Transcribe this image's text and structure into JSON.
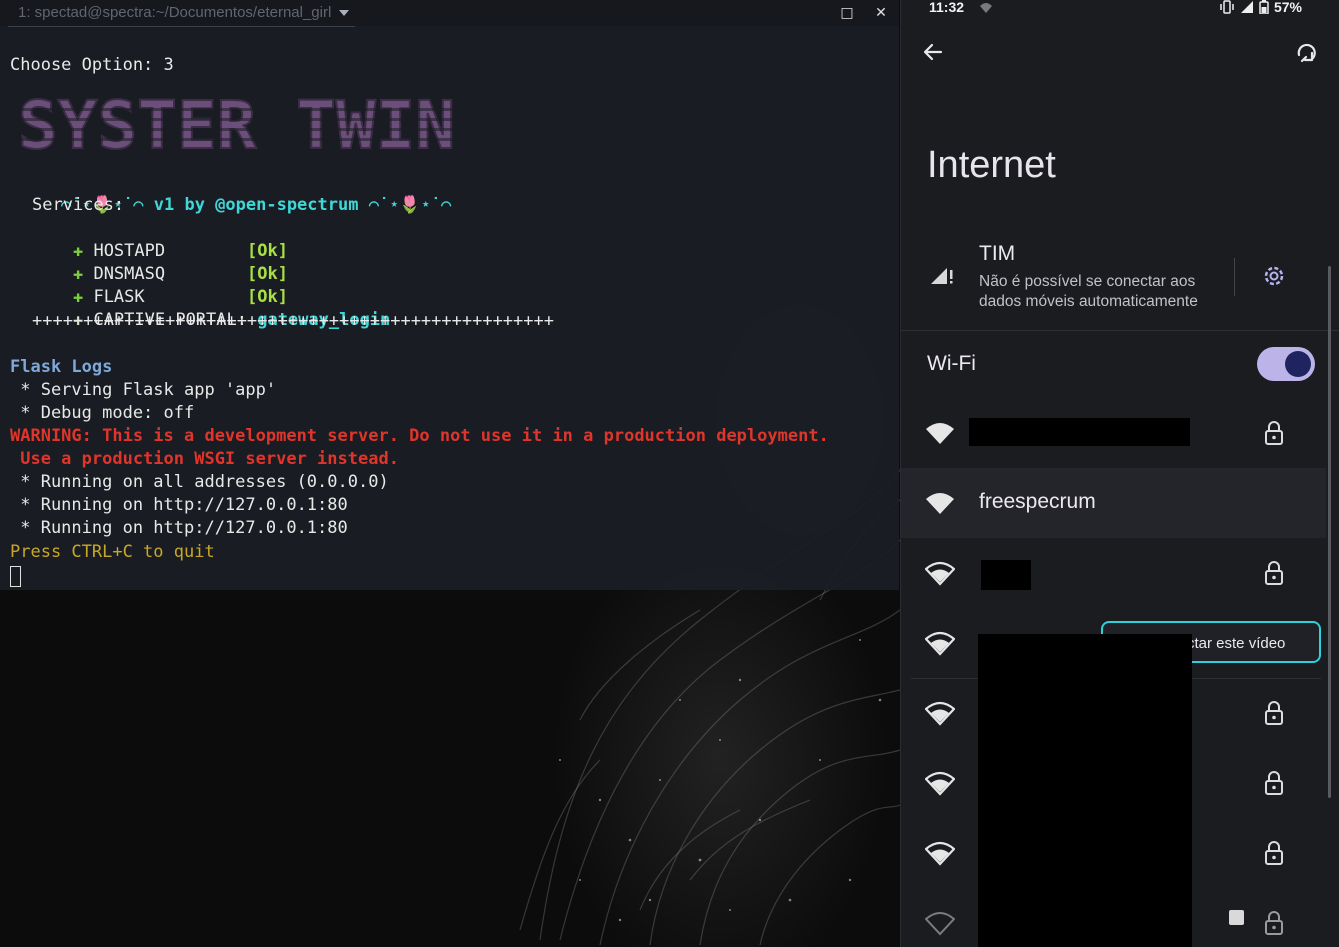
{
  "terminal": {
    "tab_title": "1: spectad@spectra:~/Documentos/eternal_girl",
    "maximize_glyph": "□",
    "close_glyph": "✕",
    "prompt_line": "Choose Option: 3",
    "logo_text": "SYSTER TWIN",
    "banner_left": "⌒˙⋆🌷⋆˙⌒ ",
    "banner_version": "v1 by @open-spectrum",
    "banner_right": " ⌒˙⋆🌷⋆˙⌒",
    "services_header": "Services:",
    "services": [
      {
        "name": "HOSTAPD        ",
        "status": "[Ok]"
      },
      {
        "name": "DNSMASQ        ",
        "status": "[Ok]"
      },
      {
        "name": "FLASK          ",
        "status": "[Ok]"
      },
      {
        "name": "CAPTIVE PORTAL: ",
        "status": "gateway_login"
      }
    ],
    "separator": "+++++++++++++++++++++++++++++++++++++++++++++++++++",
    "flask_logs_header": "Flask Logs",
    "log_serving": " * Serving Flask app 'app'",
    "log_debug": " * Debug mode: off",
    "warning_1": "WARNING: This is a development server. Do not use it in a production deployment.",
    "warning_2": " Use a production WSGI server instead.",
    "log_all": " * Running on all addresses (0.0.0.0)",
    "log_run_1": " * Running on http://127.0.0.1:80",
    "log_run_2": " * Running on http://127.0.0.1:80",
    "quit_line": "Press CTRL+C to quit"
  },
  "phone": {
    "clock": "11:32",
    "battery": "57%",
    "title": "Internet",
    "carrier": "TIM",
    "carrier_status": "Não é possível se conectar aos dados móveis automaticamente",
    "wifi_label": "Wi-Fi",
    "wifi_enabled": true,
    "connected_network": "freespecrum",
    "cast_label": "ctar este vídeo",
    "colors": {
      "accent": "#bcb3e8",
      "cast_border": "#2ed0d9"
    }
  }
}
